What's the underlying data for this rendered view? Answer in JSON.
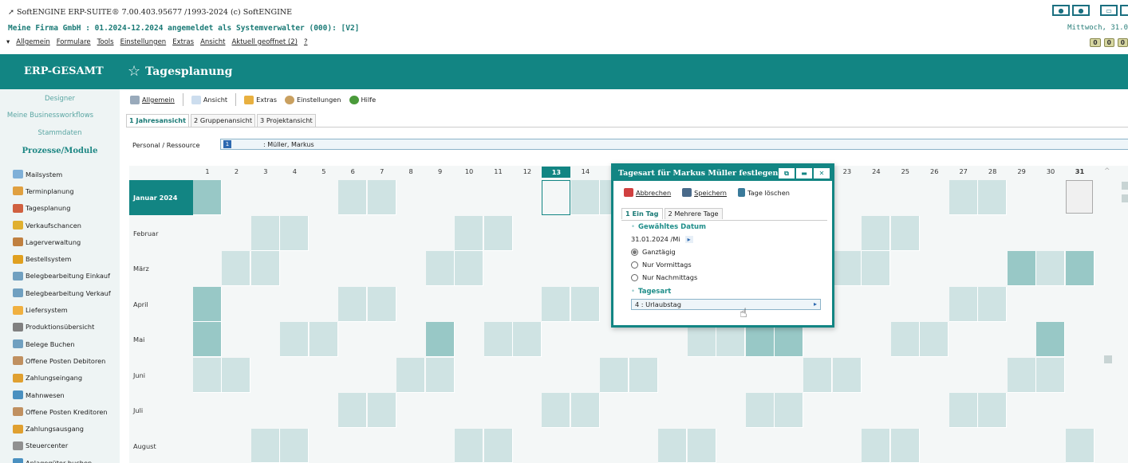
{
  "window": {
    "title": "SoftENGINE ERP-SUITE® 7.00.403.95677 /1993-2024 (c) SoftENGINE",
    "session": "Meine Firma GmbH : 01.2024-12.2024 angemeldet als Systemverwalter (000): [V2]",
    "date_partial": "Mittwoch, 31.0",
    "menu": [
      "Allgemein",
      "Formulare",
      "Tools",
      "Einstellungen",
      "Extras",
      "Ansicht",
      "Aktuell geoffnet (2)",
      "?"
    ]
  },
  "header": {
    "brand": "ERP-GESAMT",
    "page_title": "Tagesplanung"
  },
  "sidebar": {
    "designer": "Designer",
    "workflows": "Meine Businessworkflows",
    "stammdaten": "Stammdaten",
    "prozesse": "Prozesse/Module",
    "items": [
      {
        "label": "Mailsystem",
        "color": "#7fb0d8"
      },
      {
        "label": "Terminplanung",
        "color": "#e0a040"
      },
      {
        "label": "Tagesplanung",
        "color": "#d06040"
      },
      {
        "label": "Verkaufschancen",
        "color": "#e0b030"
      },
      {
        "label": "Lagerverwaltung",
        "color": "#c08040"
      },
      {
        "label": "Bestellsystem",
        "color": "#e0a020"
      },
      {
        "label": "Belegbearbeitung Einkauf",
        "color": "#70a0c0"
      },
      {
        "label": "Belegbearbeitung Verkauf",
        "color": "#70a0c0"
      },
      {
        "label": "Liefersystem",
        "color": "#f0b040"
      },
      {
        "label": "Produktionsübersicht",
        "color": "#808080"
      },
      {
        "label": "Belege Buchen",
        "color": "#70a0c0"
      },
      {
        "label": "Offene Posten Debitoren",
        "color": "#c09060"
      },
      {
        "label": "Zahlungseingang",
        "color": "#e0a030"
      },
      {
        "label": "Mahnwesen",
        "color": "#4a90c0"
      },
      {
        "label": "Offene Posten Kreditoren",
        "color": "#c09060"
      },
      {
        "label": "Zahlungsausgang",
        "color": "#e0a030"
      },
      {
        "label": "Steuercenter",
        "color": "#909090"
      },
      {
        "label": "Anlagegüter buchen",
        "color": "#4a90c0"
      }
    ]
  },
  "toolbar": {
    "allgemein": "Allgemein",
    "ansicht": "Ansicht",
    "extras": "Extras",
    "einstellungen": "Einstellungen",
    "hilfe": "Hilfe"
  },
  "tabs": [
    "1 Jahresansicht",
    "2 Gruppenansicht",
    "3 Projektansicht"
  ],
  "person": {
    "label": "Personal / Ressource",
    "id": "1",
    "name": ": Müller, Markus"
  },
  "calendar": {
    "days": [
      "1",
      "2",
      "3",
      "4",
      "5",
      "6",
      "7",
      "8",
      "9",
      "10",
      "11",
      "12",
      "13",
      "14",
      "15",
      "16",
      "17",
      "18",
      "19",
      "20",
      "21",
      "22",
      "23",
      "24",
      "25",
      "26",
      "27",
      "28",
      "29",
      "30",
      "31"
    ],
    "today_day": "13",
    "months": [
      "Januar 2024",
      "Februar",
      "März",
      "April",
      "Mai",
      "Juni",
      "Juli",
      "August"
    ],
    "active_month": "Januar 2024"
  },
  "dialog": {
    "title": "Tagesart für Markus Müller festlegen",
    "abbrechen": "Abbrechen",
    "speichern": "Speichern",
    "tage_loeschen": "Tage löschen",
    "tab1": "1 Ein Tag",
    "tab2": "2 Mehrere Tage",
    "section_date": "Gewähltes Datum",
    "date_value": "31.01.2024 /Mi",
    "opt1": "Ganztägig",
    "opt2": "Nur Vormittags",
    "opt3": "Nur Nachmittags",
    "selected_option": "Ganztägig",
    "section_type": "Tagesart",
    "type_value": "4   : Urlaubstag"
  },
  "status": [
    "0",
    "0",
    "0"
  ]
}
